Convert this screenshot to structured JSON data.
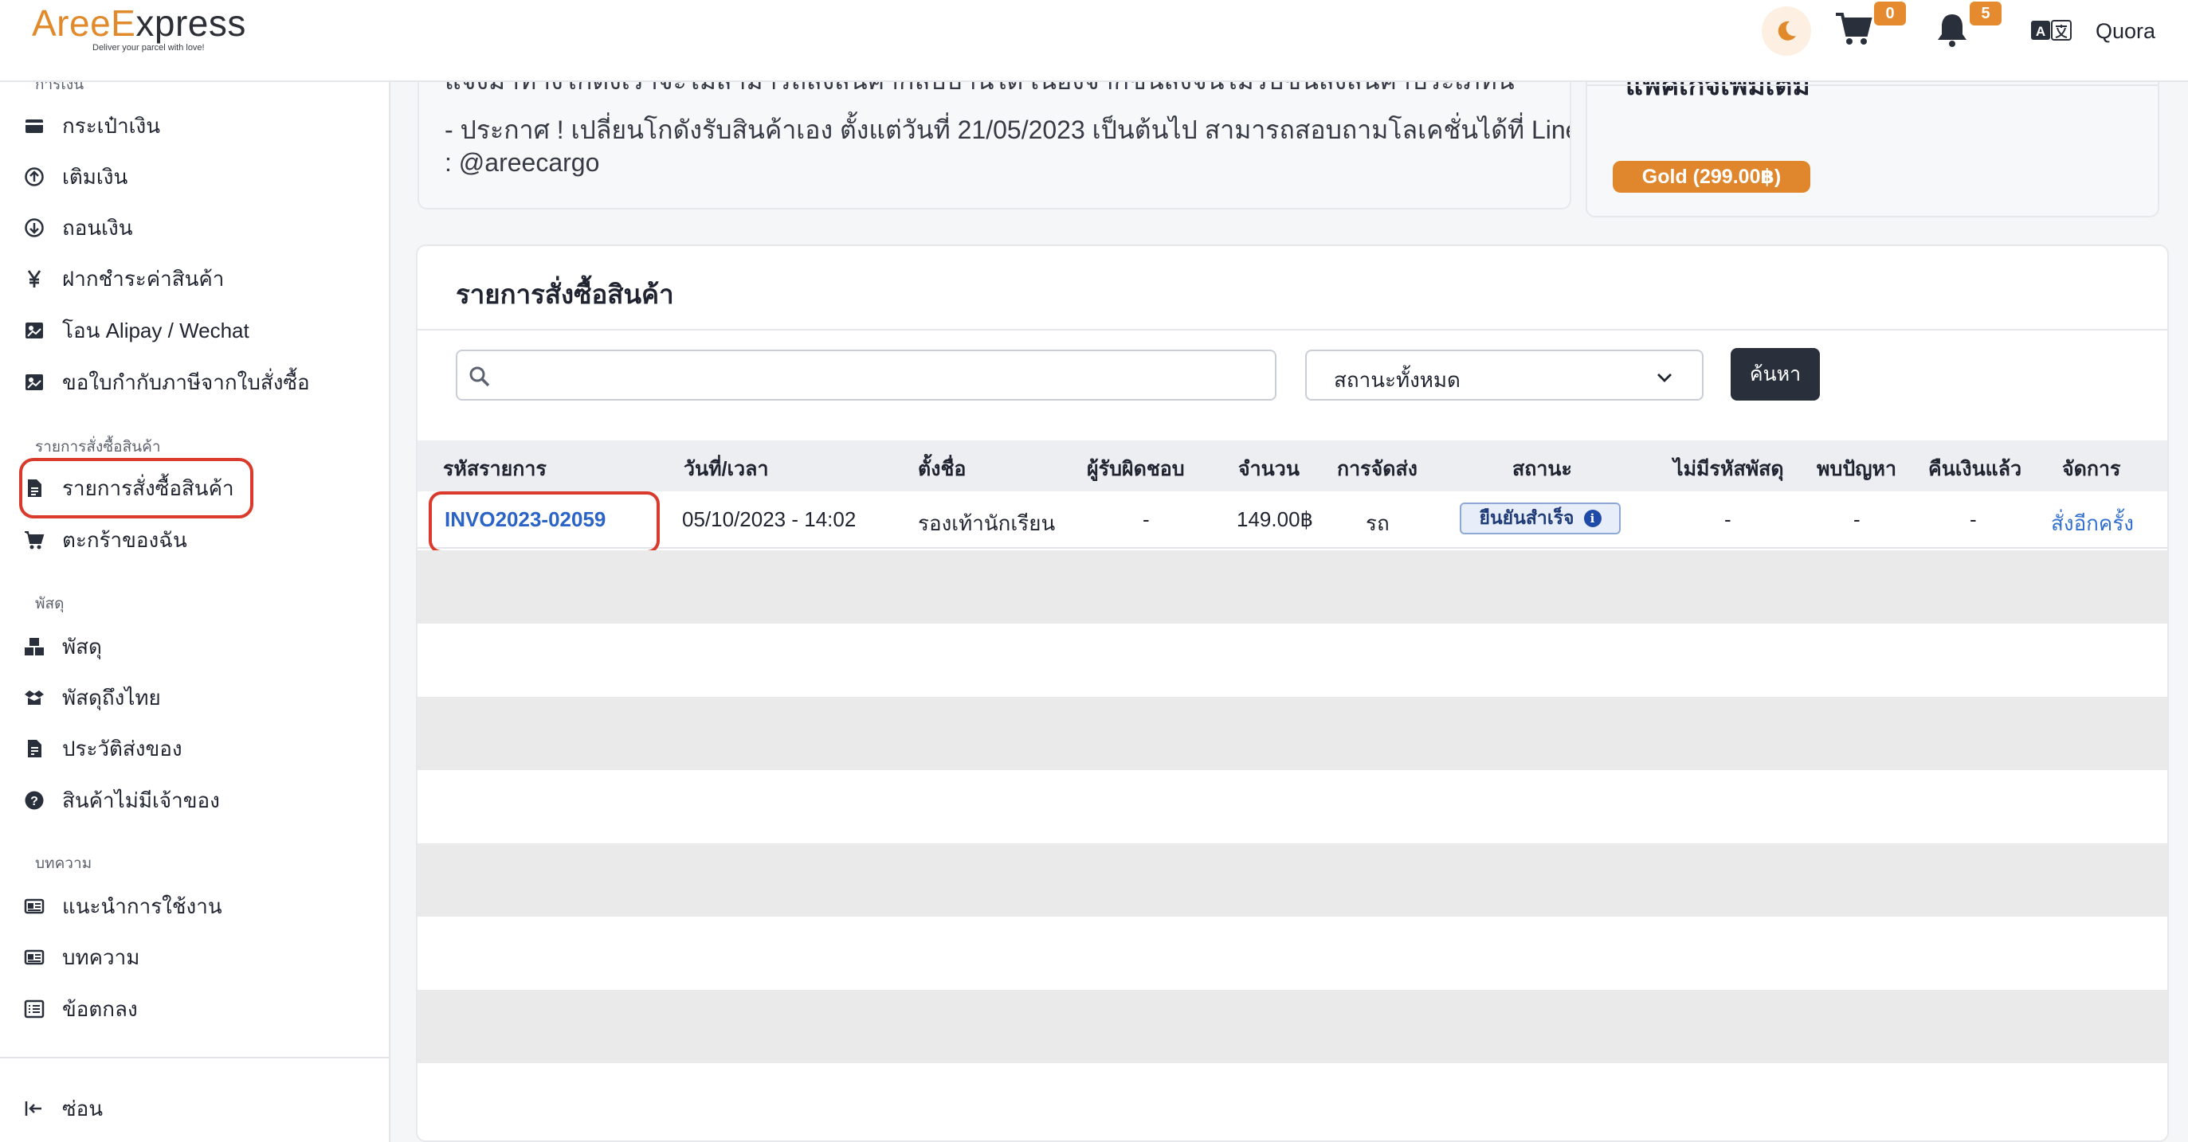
{
  "header": {
    "logo_text_part1": "AreeE",
    "logo_text_part2": "xpress",
    "logo_tagline": "Deliver your parcel with love!",
    "cart_count": "0",
    "notification_count": "5",
    "user_name": "Quora"
  },
  "sidebar": {
    "groups": {
      "wallet": "การเงิน",
      "orders": "รายการสั่งซื้อสินค้า",
      "parcels": "พัสดุ",
      "articles": "บทความ"
    },
    "items": [
      {
        "label": "กระเป๋าเงิน",
        "icon": "wallet-icon"
      },
      {
        "label": "เติมเงิน",
        "icon": "arrow-circle-up-icon"
      },
      {
        "label": "ถอนเงิน",
        "icon": "arrow-circle-down-icon"
      },
      {
        "label": "ฝากชำระค่าสินค้า",
        "icon": "yen-icon"
      },
      {
        "label": "โอน Alipay / Wechat",
        "icon": "transfer-icon"
      },
      {
        "label": "ขอใบกำกับภาษีจากใบสั่งซื้อ",
        "icon": "invoice-icon"
      },
      {
        "label": "รายการสั่งซื้อสินค้า",
        "icon": "document-icon"
      },
      {
        "label": "ตะกร้าของฉัน",
        "icon": "cart-icon"
      },
      {
        "label": "พัสดุ",
        "icon": "boxes-icon"
      },
      {
        "label": "พัสดุถึงไทย",
        "icon": "box-open-icon"
      },
      {
        "label": "ประวัติส่งของ",
        "icon": "history-icon"
      },
      {
        "label": "สินค้าไม่มีเจ้าของ",
        "icon": "question-circle-icon"
      },
      {
        "label": "แนะนำการใช้งาน",
        "icon": "newspaper-icon"
      },
      {
        "label": "บทความ",
        "icon": "newspaper-icon"
      },
      {
        "label": "ข้อตกลง",
        "icon": "list-icon"
      }
    ],
    "collapse_label": "ซ่อน"
  },
  "notice": {
    "line1": "แจ้งมาทางโกดังเราจะไม่สามารถส่งสินค้ากลับบ้านได้ เนื่องจากขนส่งจีนไม่รับขนส่งสินค้าประเภทนี้",
    "line2": "- ประกาศ ! เปลี่ยนโกดังรับสินค้าเอง ตั้งแต่วันที่ 21/05/2023 เป็นต้นไป สามารถสอบถามโลเคชั่นได้ที่ Line",
    "line3": ": @areecargo"
  },
  "package": {
    "title": "แพคเกจเพิ่มเติม",
    "badge": "Gold (299.00฿)"
  },
  "orders": {
    "title": "รายการสั่งซื้อสินค้า",
    "search_value": "",
    "status_filter": "สถานะทั้งหมด",
    "search_button": "ค้นหา",
    "columns": [
      "รหัสรายการ",
      "วันที่/เวลา",
      "ตั้งชื่อ",
      "ผู้รับผิดชอบ",
      "จำนวน",
      "การจัดส่ง",
      "สถานะ",
      "ไม่มีรหัสพัสดุ",
      "พบปัญหา",
      "คืนเงินแล้ว",
      "จัดการ"
    ],
    "rows": [
      {
        "id": "INVO2023-02059",
        "datetime": "05/10/2023 - 14:02",
        "name": "รองเท้านักเรียน",
        "responsible": "-",
        "amount": "149.00฿",
        "shipping": "รถ",
        "status": "ยืนยันสำเร็จ",
        "no_tracking": "-",
        "problem": "-",
        "refunded": "-",
        "action": "สั่งอีกครั้ง"
      }
    ]
  },
  "colors": {
    "accent": "#e08a2c",
    "highlight_border": "#d93a2b",
    "link": "#2b63c7",
    "dark_button": "#2a303b"
  }
}
